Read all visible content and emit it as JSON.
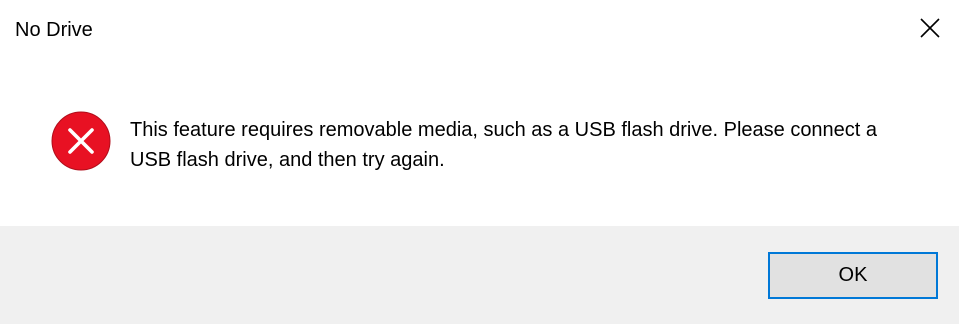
{
  "window": {
    "title": "No Drive"
  },
  "title_bar": {
    "close_icon": "close-icon"
  },
  "content": {
    "icon": "error-icon",
    "message": "This feature requires removable media, such as a USB flash drive. Please connect a USB flash drive, and then try again."
  },
  "buttons": {
    "ok_label": "OK"
  },
  "colors": {
    "error_red": "#e81123",
    "focus_border": "#0078d7",
    "button_face": "#e1e1e1",
    "footer_background": "#f0f0f0"
  }
}
